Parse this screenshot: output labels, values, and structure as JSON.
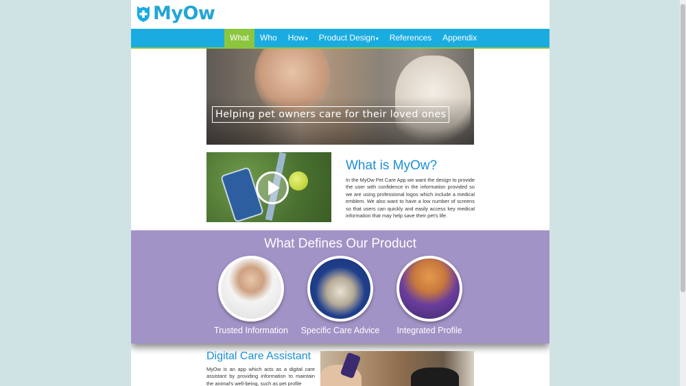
{
  "brand": {
    "name": "MyOw",
    "color": "#22a6d6"
  },
  "nav": {
    "items": [
      {
        "label": "What",
        "active": true
      },
      {
        "label": "Who"
      },
      {
        "label": "How",
        "dropdown": true
      },
      {
        "label": "Product Design",
        "dropdown": true
      },
      {
        "label": "References"
      },
      {
        "label": "Appendix"
      }
    ],
    "caret": "▾"
  },
  "hero": {
    "caption": "Helping pet owners care for their loved ones"
  },
  "what": {
    "title": "What is MyOw?",
    "body": "In the MyOw Pet Care App we want the design to provide the user with confidence in the information provided so we are using professional logos which include a medical emblem. We also want to have a low number of screens so that users can quickly and easily access key medical information that may help save their pet's life."
  },
  "product": {
    "title": "What Defines Our Product",
    "features": [
      {
        "label": "Trusted Information"
      },
      {
        "label": "Specific Care Advice"
      },
      {
        "label": "Integrated Profile"
      }
    ]
  },
  "dca": {
    "title": "Digital Care Assistant",
    "body": "MyOw is an app which acts as a digital care assistant by providing information to maintain the animal's well-being, such as pet profile"
  },
  "colors": {
    "nav": "#1aace0",
    "active": "#8cc63f",
    "purple": "#a293c6",
    "heading": "#1a8fd6"
  }
}
